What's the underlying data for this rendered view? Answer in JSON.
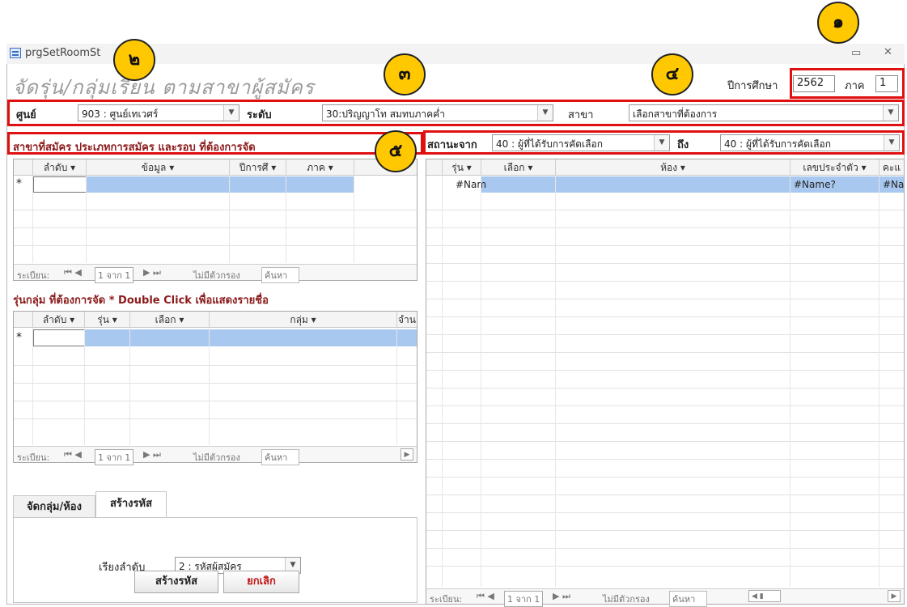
{
  "window": {
    "title": "prgSetRoomSt"
  },
  "form": {
    "heading": "จัดรุ่น/กลุ่มเรียน ตามสาขาผู้สมัคร",
    "year_label": "ปีการศึกษา",
    "year_value": "2562",
    "term_label": "ภาค",
    "term_value": "1",
    "center_label": "ศูนย์",
    "center_value": "903 : ศูนย์เทเวศร์",
    "level_label": "ระดับ",
    "level_value": "30:ปริญญาโท สมทบภาคค่ำ",
    "branch_label": "สาขา",
    "branch_value": "เลือกสาขาที่ต้องการ",
    "section1_title": "สาขาที่สมัคร ประเภทการสมัคร และรอบ ที่ต้องการจัด",
    "status_from_label": "สถานะจาก",
    "status_from_value": "40 : ผู้ที่ได้รับการคัดเลือก",
    "status_to_label": "ถึง",
    "status_to_value": "40 : ผู้ที่ได้รับการคัดเลือก",
    "section2_title": "รุ่นกลุ่ม ที่ต้องการจัด * Double Click เพื่อแสดงรายชื่อ"
  },
  "grid1": {
    "columns": [
      "ลำดับ",
      "ข้อมูล",
      "ปีการศึ",
      "ภาค"
    ],
    "new_row_marker": "*",
    "nav": {
      "record_label": "ระเบียน:",
      "position": "1 จาก 1",
      "filter": "ไม่มีตัวกรอง",
      "search": "ค้นหา"
    }
  },
  "grid2": {
    "columns": [
      "ลำดับ",
      "รุ่น",
      "เลือก",
      "กลุ่ม",
      "จำน"
    ],
    "new_row_marker": "*",
    "nav": {
      "record_label": "ระเบียน:",
      "position": "1 จาก 1",
      "filter": "ไม่มีตัวกรอง",
      "search": "ค้นหา"
    }
  },
  "grid3": {
    "columns": [
      "รุ่น",
      "เลือก",
      "ห้อง",
      "เลขประจำตัว",
      "คะแ"
    ],
    "row": [
      "#Nam",
      "",
      "",
      "#Name?",
      "#Na"
    ],
    "nav": {
      "record_label": "ระเบียน:",
      "position": "1 จาก 1",
      "filter": "ไม่มีตัวกรอง",
      "search": "ค้นหา"
    }
  },
  "tabs": [
    "จัดกลุ่ม/ห้อง",
    "สร้างรหัส"
  ],
  "sort": {
    "label": "เรียงลำดับ",
    "value": "2 : รหัสผู้สมัคร"
  },
  "buttons": {
    "create": "สร้างรหัส",
    "cancel": "ยกเลิก"
  },
  "callouts": [
    "๑",
    "๒",
    "๓",
    "๔",
    "๕"
  ],
  "colors": {
    "highlight": "#e01010",
    "callout": "#ffc800",
    "section_title": "#8b1a1a",
    "selected_row": "#a9c8ef"
  }
}
